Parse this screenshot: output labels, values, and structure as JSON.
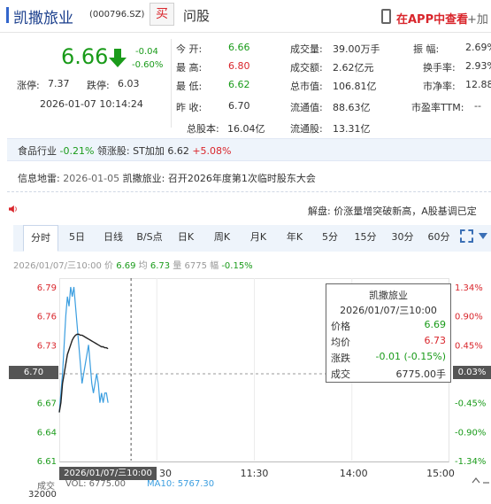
{
  "header": {
    "title": "凯撒旅业",
    "code": "(000796.SZ)",
    "buy_label": "买",
    "ask_label": "问股",
    "app_link": "在APP中查看",
    "add_label": "+加"
  },
  "quote": {
    "price": "6.66",
    "change": "-0.04",
    "change_pct": "-0.60%",
    "limit_up_label": "涨停:",
    "limit_up": "7.37",
    "limit_down_label": "跌停:",
    "limit_down": "6.03",
    "datetime": "2026-01-07 10:14:24"
  },
  "stats": {
    "open_label": "今  开:",
    "open": "6.66",
    "high_label": "最  高:",
    "high": "6.80",
    "low_label": "最  低:",
    "low": "6.62",
    "prev_close_label": "昨  收:",
    "prev_close": "6.70",
    "volume_label": "成交量:",
    "volume": "39.00万手",
    "amount_label": "成交额:",
    "amount": "2.62亿元",
    "mktcap_label": "总市值:",
    "mktcap": "106.81亿",
    "float_cap_label": "流通值:",
    "float_cap": "88.63亿",
    "amplitude_label": "振    幅:",
    "amplitude": "2.69%",
    "turnover_label": "换手率:",
    "turnover": "2.93%",
    "pb_label": "市净率:",
    "pb": "12.88",
    "pe_label": "市盈率TTM:",
    "pe": "--",
    "total_shares_label": "总股本:",
    "total_shares": "16.04亿",
    "float_shares_label": "流通股:",
    "float_shares": "13.31亿"
  },
  "industry": {
    "label": "食品行业",
    "change": "-0.21%",
    "leader_label": "领涨股:",
    "leader": "ST加加",
    "leader_price": "6.62",
    "leader_change": "+5.08%"
  },
  "info": {
    "label": "信息地雷:",
    "date": "2026-01-05",
    "text": "凯撒旅业: 召开2026年度第1次临时股东大会"
  },
  "marquee": "解盘: 价涨量增突破新高，A股基调已定",
  "tabs": [
    "分时",
    "5日",
    "日线",
    "B/S点",
    "日K",
    "周K",
    "月K",
    "年K",
    "5分",
    "15分",
    "30分",
    "60分"
  ],
  "summary": {
    "time": "2026/01/07/三10:00",
    "price_label": "价",
    "price": "6.69",
    "avg_label": "均",
    "avg": "6.73",
    "vol_label": "量",
    "vol": "6775",
    "pct_label": "幅",
    "pct": "-0.15%"
  },
  "chart_data": {
    "type": "line",
    "y_ticks": [
      "6.79",
      "6.76",
      "6.73",
      "6.70",
      "6.67",
      "6.64",
      "6.61"
    ],
    "pct_ticks": [
      "1.34%",
      "0.90%",
      "0.45%",
      "0.03%",
      "-0.45%",
      "-0.90%",
      "-1.34%"
    ],
    "x_ticks": [
      "11:30",
      "14:00",
      "15:00"
    ],
    "ylim": [
      6.61,
      6.79
    ],
    "prev_close": 6.7,
    "series": [
      {
        "values": [
          6.66,
          6.68,
          6.7,
          6.73,
          6.76,
          6.78,
          6.77,
          6.79,
          6.78,
          6.79,
          6.77,
          6.75,
          6.73,
          6.71,
          6.69,
          6.7,
          6.71,
          6.72,
          6.73,
          6.71,
          6.69,
          6.68,
          6.69,
          6.7,
          6.69,
          6.67,
          6.68,
          6.67,
          6.68,
          6.68,
          6.67
        ],
        "color": "#3b9ee0"
      },
      {
        "values": [
          6.66,
          6.67,
          6.69,
          6.7,
          6.71,
          6.72,
          6.725,
          6.73,
          6.735,
          6.738,
          6.74,
          6.741,
          6.741,
          6.74,
          6.74,
          6.739,
          6.738,
          6.737,
          6.736,
          6.735,
          6.734,
          6.733,
          6.732,
          6.731,
          6.73,
          6.729,
          6.728,
          6.728,
          6.727,
          6.727,
          6.726
        ],
        "color": "#222222"
      }
    ]
  },
  "tooltip": {
    "title": "凯撒旅业",
    "time": "2026/01/07/三10:00",
    "price_label": "价格",
    "price": "6.69",
    "avg_label": "均价",
    "avg": "6.73",
    "chg_label": "涨跌",
    "chg": "-0.01 (-0.15%)",
    "vol_label": "成交",
    "vol": "6775.00手"
  },
  "crosshair": {
    "price": "6.70",
    "pct": "0.03%",
    "time": "2026/01/07/三10:00"
  },
  "bottom": {
    "vol_label": "成交",
    "vol_text": "VOL: 6775.00",
    "ma_text": "MA10: 5767.30",
    "scale": "32000"
  },
  "colors": {
    "up": "#d9262c",
    "down": "#1a9b1a",
    "price_line": "#3b9ee0",
    "avg_line": "#222222",
    "accent": "#1a3e8c"
  }
}
